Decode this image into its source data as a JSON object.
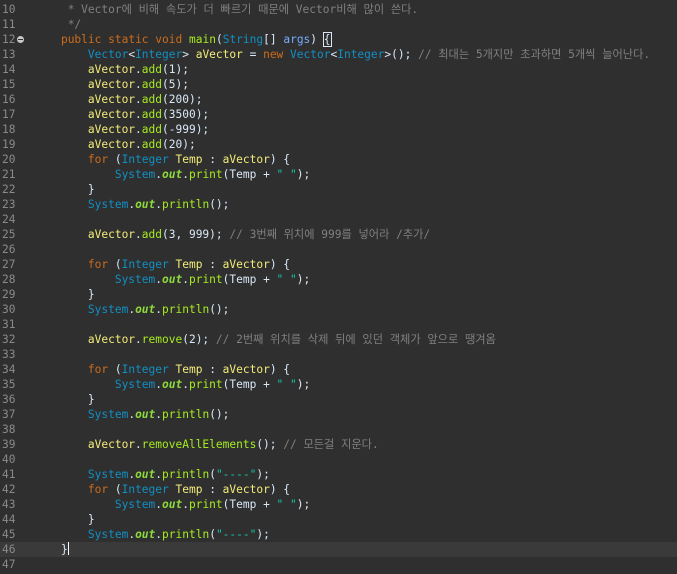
{
  "editor": {
    "lines": [
      {
        "n": "10",
        "indent": "     ",
        "segs": [
          {
            "c": "cmt",
            "t": "* Vector에 비해 속도가 더 빠르기 때문에 Vector비해 많이 쓴다."
          }
        ]
      },
      {
        "n": "11",
        "indent": "     ",
        "segs": [
          {
            "c": "cmt",
            "t": "*/"
          }
        ]
      },
      {
        "n": "12",
        "indent": "    ",
        "fold": true,
        "segs": [
          {
            "c": "kw",
            "t": "public"
          },
          {
            "c": "",
            "t": " "
          },
          {
            "c": "kw",
            "t": "static"
          },
          {
            "c": "",
            "t": " "
          },
          {
            "c": "kw",
            "t": "void"
          },
          {
            "c": "",
            "t": " "
          },
          {
            "c": "mth",
            "t": "main"
          },
          {
            "c": "",
            "t": "("
          },
          {
            "c": "type",
            "t": "String"
          },
          {
            "c": "",
            "t": "[] "
          },
          {
            "c": "param",
            "t": "args"
          },
          {
            "c": "",
            "t": ") "
          },
          {
            "c": "bracket",
            "t": "{"
          }
        ]
      },
      {
        "n": "13",
        "indent": "        ",
        "segs": [
          {
            "c": "type",
            "t": "Vector"
          },
          {
            "c": "",
            "t": "<"
          },
          {
            "c": "type",
            "t": "Integer"
          },
          {
            "c": "",
            "t": "> "
          },
          {
            "c": "var",
            "t": "aVector"
          },
          {
            "c": "",
            "t": " = "
          },
          {
            "c": "kw",
            "t": "new"
          },
          {
            "c": "",
            "t": " "
          },
          {
            "c": "type",
            "t": "Vector"
          },
          {
            "c": "",
            "t": "<"
          },
          {
            "c": "type",
            "t": "Integer"
          },
          {
            "c": "",
            "t": ">(); "
          },
          {
            "c": "cmt",
            "t": "// 최대는 5개지만 초과하면 5개씩 늘어난다."
          }
        ]
      },
      {
        "n": "14",
        "indent": "        ",
        "segs": [
          {
            "c": "var",
            "t": "aVector"
          },
          {
            "c": "",
            "t": "."
          },
          {
            "c": "mth",
            "t": "add"
          },
          {
            "c": "",
            "t": "(1);"
          }
        ]
      },
      {
        "n": "15",
        "indent": "        ",
        "segs": [
          {
            "c": "var",
            "t": "aVector"
          },
          {
            "c": "",
            "t": "."
          },
          {
            "c": "mth",
            "t": "add"
          },
          {
            "c": "",
            "t": "(5);"
          }
        ]
      },
      {
        "n": "16",
        "indent": "        ",
        "segs": [
          {
            "c": "var",
            "t": "aVector"
          },
          {
            "c": "",
            "t": "."
          },
          {
            "c": "mth",
            "t": "add"
          },
          {
            "c": "",
            "t": "(200);"
          }
        ]
      },
      {
        "n": "17",
        "indent": "        ",
        "segs": [
          {
            "c": "var",
            "t": "aVector"
          },
          {
            "c": "",
            "t": "."
          },
          {
            "c": "mth",
            "t": "add"
          },
          {
            "c": "",
            "t": "(3500);"
          }
        ]
      },
      {
        "n": "18",
        "indent": "        ",
        "segs": [
          {
            "c": "var",
            "t": "aVector"
          },
          {
            "c": "",
            "t": "."
          },
          {
            "c": "mth",
            "t": "add"
          },
          {
            "c": "",
            "t": "(-999);"
          }
        ]
      },
      {
        "n": "19",
        "indent": "        ",
        "segs": [
          {
            "c": "var",
            "t": "aVector"
          },
          {
            "c": "",
            "t": "."
          },
          {
            "c": "mth",
            "t": "add"
          },
          {
            "c": "",
            "t": "(20);"
          }
        ]
      },
      {
        "n": "20",
        "indent": "        ",
        "segs": [
          {
            "c": "kw",
            "t": "for"
          },
          {
            "c": "",
            "t": " ("
          },
          {
            "c": "type",
            "t": "Integer"
          },
          {
            "c": "",
            "t": " "
          },
          {
            "c": "var",
            "t": "Temp"
          },
          {
            "c": "",
            "t": " : "
          },
          {
            "c": "var",
            "t": "aVector"
          },
          {
            "c": "",
            "t": ") {"
          }
        ]
      },
      {
        "n": "21",
        "indent": "            ",
        "segs": [
          {
            "c": "type",
            "t": "System"
          },
          {
            "c": "",
            "t": "."
          },
          {
            "c": "fld",
            "t": "out"
          },
          {
            "c": "",
            "t": "."
          },
          {
            "c": "mth",
            "t": "print"
          },
          {
            "c": "",
            "t": "(Temp + "
          },
          {
            "c": "str",
            "t": "\" \""
          },
          {
            "c": "",
            "t": ");"
          }
        ]
      },
      {
        "n": "22",
        "indent": "        ",
        "segs": [
          {
            "c": "",
            "t": "}"
          }
        ]
      },
      {
        "n": "23",
        "indent": "        ",
        "segs": [
          {
            "c": "type",
            "t": "System"
          },
          {
            "c": "",
            "t": "."
          },
          {
            "c": "fld",
            "t": "out"
          },
          {
            "c": "",
            "t": "."
          },
          {
            "c": "mth",
            "t": "println"
          },
          {
            "c": "",
            "t": "();"
          }
        ]
      },
      {
        "n": "24",
        "indent": "",
        "segs": []
      },
      {
        "n": "25",
        "indent": "        ",
        "segs": [
          {
            "c": "var",
            "t": "aVector"
          },
          {
            "c": "",
            "t": "."
          },
          {
            "c": "mth",
            "t": "add"
          },
          {
            "c": "",
            "t": "(3, 999); "
          },
          {
            "c": "cmt",
            "t": "// 3번째 위치에 999를 넣어라 /추가/"
          }
        ]
      },
      {
        "n": "26",
        "indent": "",
        "segs": []
      },
      {
        "n": "27",
        "indent": "        ",
        "segs": [
          {
            "c": "kw",
            "t": "for"
          },
          {
            "c": "",
            "t": " ("
          },
          {
            "c": "type",
            "t": "Integer"
          },
          {
            "c": "",
            "t": " "
          },
          {
            "c": "var",
            "t": "Temp"
          },
          {
            "c": "",
            "t": " : "
          },
          {
            "c": "var",
            "t": "aVector"
          },
          {
            "c": "",
            "t": ") {"
          }
        ]
      },
      {
        "n": "28",
        "indent": "            ",
        "segs": [
          {
            "c": "type",
            "t": "System"
          },
          {
            "c": "",
            "t": "."
          },
          {
            "c": "fld",
            "t": "out"
          },
          {
            "c": "",
            "t": "."
          },
          {
            "c": "mth",
            "t": "print"
          },
          {
            "c": "",
            "t": "(Temp + "
          },
          {
            "c": "str",
            "t": "\" \""
          },
          {
            "c": "",
            "t": ");"
          }
        ]
      },
      {
        "n": "29",
        "indent": "        ",
        "segs": [
          {
            "c": "",
            "t": "}"
          }
        ]
      },
      {
        "n": "30",
        "indent": "        ",
        "segs": [
          {
            "c": "type",
            "t": "System"
          },
          {
            "c": "",
            "t": "."
          },
          {
            "c": "fld",
            "t": "out"
          },
          {
            "c": "",
            "t": "."
          },
          {
            "c": "mth",
            "t": "println"
          },
          {
            "c": "",
            "t": "();"
          }
        ]
      },
      {
        "n": "31",
        "indent": "",
        "segs": []
      },
      {
        "n": "32",
        "indent": "        ",
        "segs": [
          {
            "c": "var",
            "t": "aVector"
          },
          {
            "c": "",
            "t": "."
          },
          {
            "c": "mth",
            "t": "remove"
          },
          {
            "c": "",
            "t": "(2); "
          },
          {
            "c": "cmt",
            "t": "// 2번째 위치를 삭제 뒤에 있던 객체가 앞으로 땡겨옴"
          }
        ]
      },
      {
        "n": "33",
        "indent": "",
        "segs": []
      },
      {
        "n": "34",
        "indent": "        ",
        "segs": [
          {
            "c": "kw",
            "t": "for"
          },
          {
            "c": "",
            "t": " ("
          },
          {
            "c": "type",
            "t": "Integer"
          },
          {
            "c": "",
            "t": " "
          },
          {
            "c": "var",
            "t": "Temp"
          },
          {
            "c": "",
            "t": " : "
          },
          {
            "c": "var",
            "t": "aVector"
          },
          {
            "c": "",
            "t": ") {"
          }
        ]
      },
      {
        "n": "35",
        "indent": "            ",
        "segs": [
          {
            "c": "type",
            "t": "System"
          },
          {
            "c": "",
            "t": "."
          },
          {
            "c": "fld",
            "t": "out"
          },
          {
            "c": "",
            "t": "."
          },
          {
            "c": "mth",
            "t": "print"
          },
          {
            "c": "",
            "t": "(Temp + "
          },
          {
            "c": "str",
            "t": "\" \""
          },
          {
            "c": "",
            "t": ");"
          }
        ]
      },
      {
        "n": "36",
        "indent": "        ",
        "segs": [
          {
            "c": "",
            "t": "}"
          }
        ]
      },
      {
        "n": "37",
        "indent": "        ",
        "segs": [
          {
            "c": "type",
            "t": "System"
          },
          {
            "c": "",
            "t": "."
          },
          {
            "c": "fld",
            "t": "out"
          },
          {
            "c": "",
            "t": "."
          },
          {
            "c": "mth",
            "t": "println"
          },
          {
            "c": "",
            "t": "();"
          }
        ]
      },
      {
        "n": "38",
        "indent": "",
        "segs": []
      },
      {
        "n": "39",
        "indent": "        ",
        "segs": [
          {
            "c": "var",
            "t": "aVector"
          },
          {
            "c": "",
            "t": "."
          },
          {
            "c": "mth",
            "t": "removeAllElements"
          },
          {
            "c": "",
            "t": "(); "
          },
          {
            "c": "cmt",
            "t": "// 모든걸 지운다."
          }
        ]
      },
      {
        "n": "40",
        "indent": "",
        "segs": []
      },
      {
        "n": "41",
        "indent": "        ",
        "segs": [
          {
            "c": "type",
            "t": "System"
          },
          {
            "c": "",
            "t": "."
          },
          {
            "c": "fld",
            "t": "out"
          },
          {
            "c": "",
            "t": "."
          },
          {
            "c": "mth",
            "t": "println"
          },
          {
            "c": "",
            "t": "("
          },
          {
            "c": "str",
            "t": "\"----\""
          },
          {
            "c": "",
            "t": ");"
          }
        ]
      },
      {
        "n": "42",
        "indent": "        ",
        "segs": [
          {
            "c": "kw",
            "t": "for"
          },
          {
            "c": "",
            "t": " ("
          },
          {
            "c": "type",
            "t": "Integer"
          },
          {
            "c": "",
            "t": " "
          },
          {
            "c": "var",
            "t": "Temp"
          },
          {
            "c": "",
            "t": " : "
          },
          {
            "c": "var",
            "t": "aVector"
          },
          {
            "c": "",
            "t": ") {"
          }
        ]
      },
      {
        "n": "43",
        "indent": "            ",
        "segs": [
          {
            "c": "type",
            "t": "System"
          },
          {
            "c": "",
            "t": "."
          },
          {
            "c": "fld",
            "t": "out"
          },
          {
            "c": "",
            "t": "."
          },
          {
            "c": "mth",
            "t": "print"
          },
          {
            "c": "",
            "t": "(Temp + "
          },
          {
            "c": "str",
            "t": "\" \""
          },
          {
            "c": "",
            "t": ");"
          }
        ]
      },
      {
        "n": "44",
        "indent": "        ",
        "segs": [
          {
            "c": "",
            "t": "}"
          }
        ]
      },
      {
        "n": "45",
        "indent": "        ",
        "segs": [
          {
            "c": "type",
            "t": "System"
          },
          {
            "c": "",
            "t": "."
          },
          {
            "c": "fld",
            "t": "out"
          },
          {
            "c": "",
            "t": "."
          },
          {
            "c": "mth",
            "t": "println"
          },
          {
            "c": "",
            "t": "("
          },
          {
            "c": "str",
            "t": "\"----\""
          },
          {
            "c": "",
            "t": ");"
          }
        ]
      },
      {
        "n": "46",
        "indent": "    ",
        "current": true,
        "segs": [
          {
            "c": "",
            "t": "}"
          }
        ]
      },
      {
        "n": "47",
        "indent": "",
        "segs": []
      }
    ]
  }
}
